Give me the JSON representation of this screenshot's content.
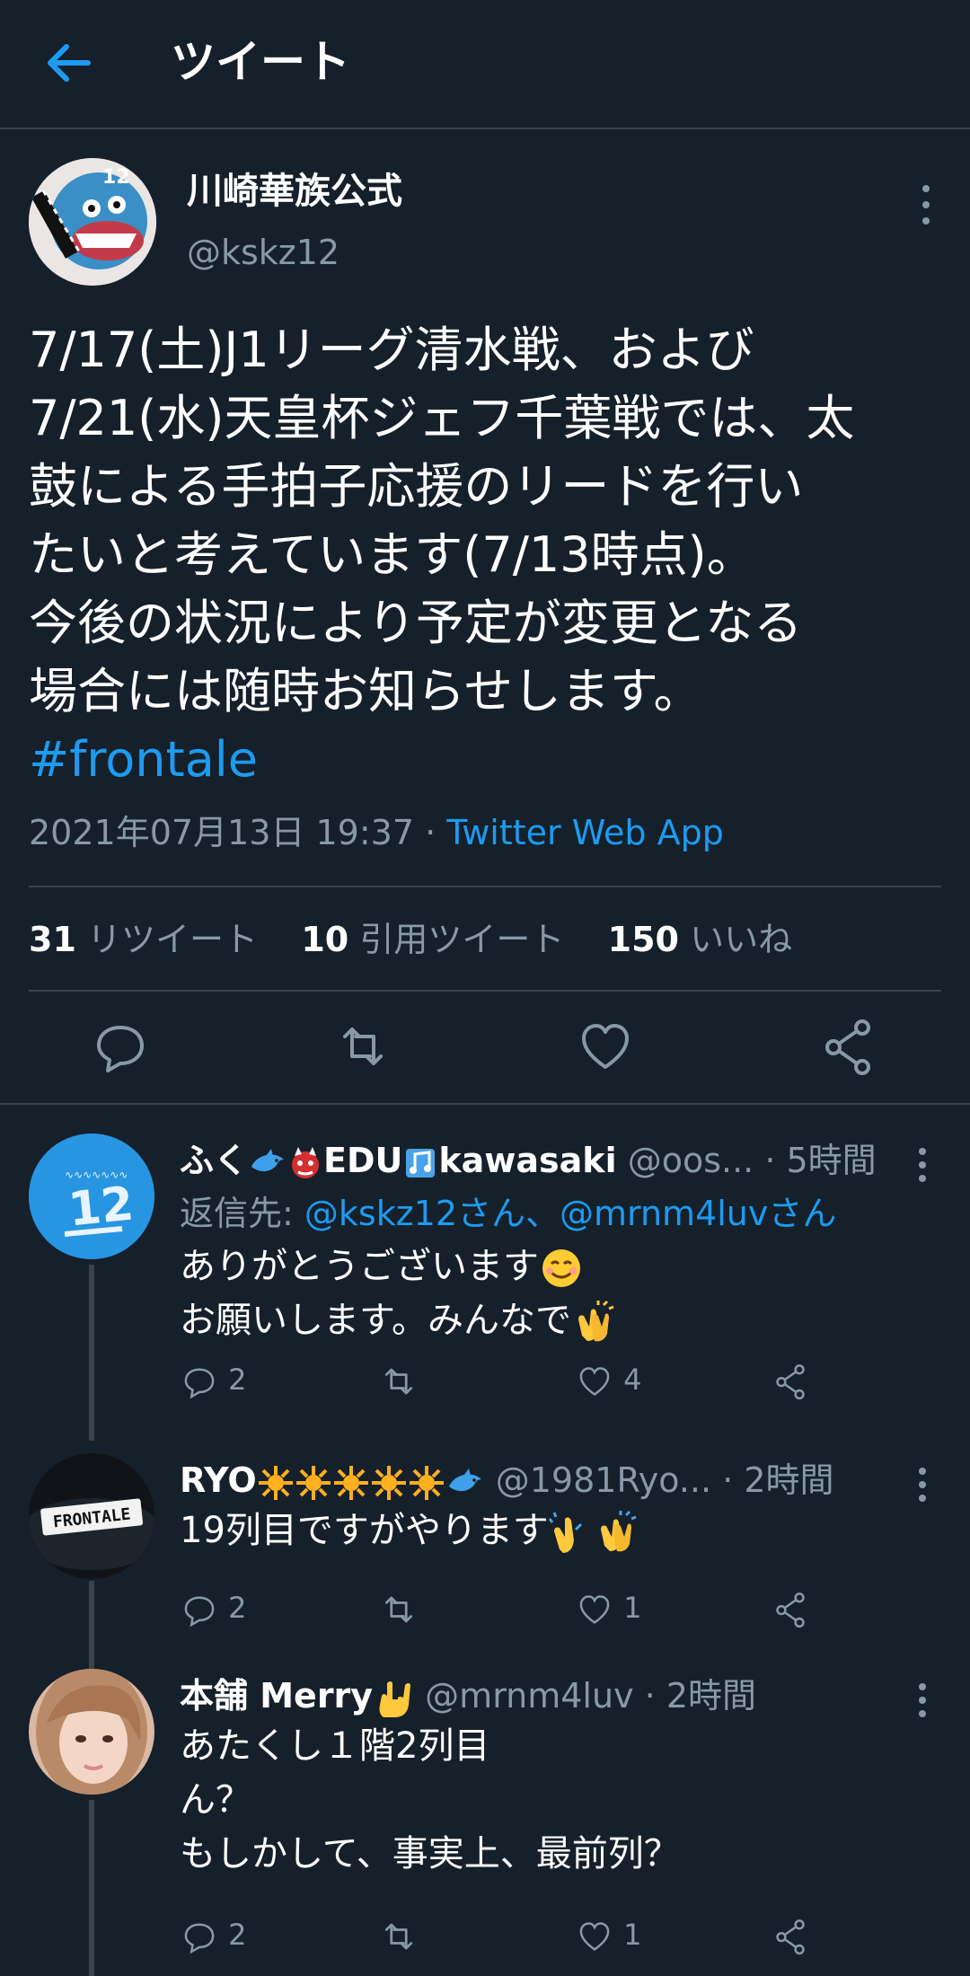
{
  "header": {
    "title": "ツイート"
  },
  "tweet": {
    "author_name": "川崎華族公式",
    "author_handle": "@kskz12",
    "lines": [
      "7/17(土)J1リーグ清水戦、および",
      "7/21(水)天皇杯ジェフ千葉戦では、太",
      "鼓による手拍子応援のリードを行い",
      "たいと考えています(7/13時点)。",
      "今後の状況により予定が変更となる",
      "場合には随時お知らせします。"
    ],
    "hashtag": "#frontale",
    "timestamp": "2021年07月13日 19:37",
    "separator": " · ",
    "source_app": "Twitter Web App",
    "stats": {
      "retweets": "31",
      "retweets_label": "リツイート",
      "quotes": "10",
      "quotes_label": "引用ツイート",
      "likes": "150",
      "likes_label": "いいね"
    }
  },
  "replies": [
    {
      "name_a": "ふく",
      "name_b": "EDU",
      "name_c": "kawasaki",
      "handle": "@oos...",
      "time": "· 5時間",
      "reply_to_label": "返信先: ",
      "reply_to": "@kskz12さん、@mrnm4luvさん",
      "lines": [
        "ありがとうございます",
        "お願いします。みんなで"
      ],
      "replies_count": "2",
      "likes_count": "4"
    },
    {
      "name_a": "RYO",
      "handle": "@1981Ryo...",
      "time": "· 2時間",
      "lines": [
        "19列目ですがやります"
      ],
      "replies_count": "2",
      "likes_count": "1",
      "avatar_text": "FRONTALE"
    },
    {
      "name_a": "本舗 Merry",
      "handle": "@mrnm4luv",
      "time": "· 2時間",
      "lines": [
        "あたくし１階2列目",
        "ん？",
        "もしかして、事実上、最前列？"
      ],
      "replies_count": "2",
      "likes_count": "1"
    }
  ],
  "colors": {
    "background": "#15202b",
    "accent": "#1d9bf0",
    "muted": "#8899a6",
    "divider": "#38444d"
  }
}
